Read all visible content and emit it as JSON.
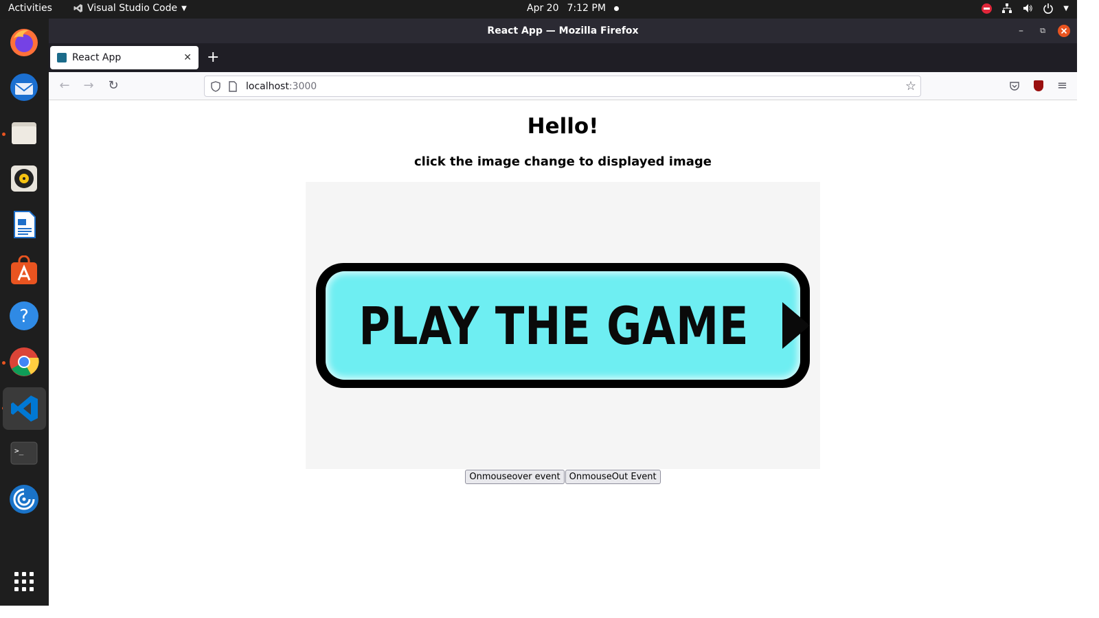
{
  "topbar": {
    "activities": "Activities",
    "app_name": "Visual Studio Code",
    "date": "Apr 20",
    "time": "7:12 PM"
  },
  "dock": {
    "items": [
      "firefox-icon",
      "thunderbird-icon",
      "files-icon",
      "rhythmbox-icon",
      "libreoffice-writer-icon",
      "app-center-icon",
      "help-icon",
      "chrome-icon",
      "vscode-icon",
      "terminal-icon",
      "remote-desktop-icon",
      "show-apps-icon"
    ]
  },
  "window": {
    "title": "React App — Mozilla Firefox"
  },
  "tabs": [
    {
      "label": "React App"
    }
  ],
  "urlbar": {
    "host": "localhost",
    "port": ":3000"
  },
  "page": {
    "heading": "Hello!",
    "subheading": "click the image change to displayed image",
    "image_text": "PLAY THE GAME",
    "buttons": {
      "mouseover": "Onmouseover event",
      "mouseout": "OnmouseOut Event"
    }
  },
  "colors": {
    "game_button_fill": "#6eeef2",
    "dock_run_indicator": "#e95420"
  }
}
